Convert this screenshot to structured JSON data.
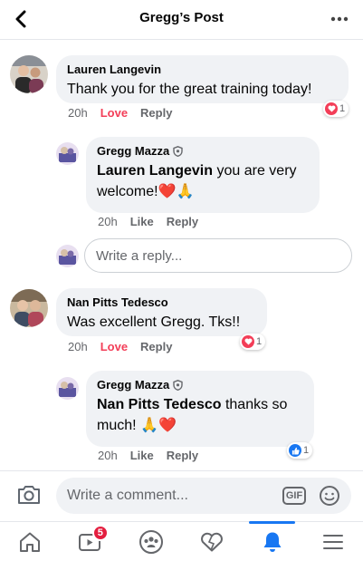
{
  "header": {
    "title": "Gregg’s Post"
  },
  "comments": [
    {
      "author": "Lauren Langevin",
      "text": "Thank you for the great training today!",
      "time": "20h",
      "action_love": "Love",
      "action_reply": "Reply",
      "reaction_count": "1",
      "reaction_type": "love"
    },
    {
      "author": "Gregg Mazza",
      "mention": "Lauren Langevin",
      "text": " you are very welcome!",
      "emoji": "❤️🙏",
      "time": "20h",
      "action_like": "Like",
      "action_reply": "Reply"
    },
    {
      "author": "Nan Pitts Tedesco",
      "text": "Was excellent Gregg. Tks!!",
      "time": "20h",
      "action_love": "Love",
      "action_reply": "Reply",
      "reaction_count": "1",
      "reaction_type": "love"
    },
    {
      "author": "Gregg Mazza",
      "mention": "Nan Pitts Tedesco",
      "text": " thanks so much! ",
      "emoji": "🙏❤️",
      "time": "20h",
      "action_like": "Like",
      "action_reply": "Reply",
      "reaction_count": "1",
      "reaction_type": "like"
    }
  ],
  "reply_box": {
    "placeholder": "Write a reply..."
  },
  "composer": {
    "placeholder": "Write a comment...",
    "gif_label": "GIF"
  },
  "tabbar": {
    "items": [
      "home-icon",
      "watch-icon",
      "groups-icon",
      "dating-icon",
      "notifications-icon",
      "menu-icon"
    ],
    "watch_badge": "5",
    "active": "notifications-icon"
  },
  "colors": {
    "accent": "#1877f2",
    "love": "#f33e58",
    "bubble": "#f0f2f5",
    "muted": "#65676b"
  }
}
